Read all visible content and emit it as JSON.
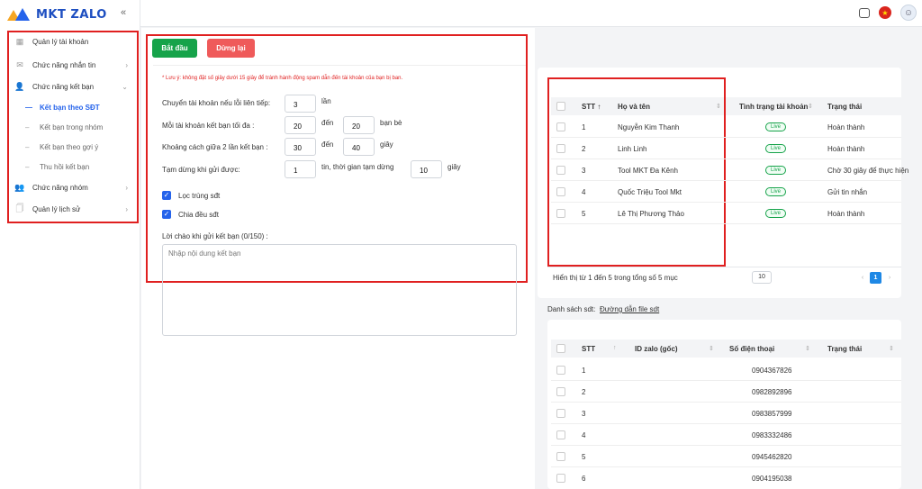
{
  "app": {
    "logo_text": "MKT ZALO",
    "collapse_icon": "«"
  },
  "sidebar": {
    "items": [
      {
        "label": "Quản lý tài khoản",
        "icon": "account-icon",
        "glyph": "▦"
      },
      {
        "label": "Chức năng nhắn tin",
        "icon": "mail-icon",
        "glyph": "✉",
        "chevron": "›"
      },
      {
        "label": "Chức năng kết bạn",
        "icon": "add-friend-icon",
        "glyph": "👤",
        "chevron": "⌄"
      },
      {
        "label": "Chức năng nhóm",
        "icon": "group-icon",
        "glyph": "👥",
        "chevron": "›"
      },
      {
        "label": "Quản lý lịch sử",
        "icon": "history-icon",
        "glyph": "🗍",
        "chevron": "›"
      }
    ],
    "subitems": [
      {
        "label": "Kết bạn theo SĐT",
        "active": true
      },
      {
        "label": "Kết bạn trong nhóm",
        "active": false
      },
      {
        "label": "Kết bạn theo gợi ý",
        "active": false
      },
      {
        "label": "Thu hồi kết bạn",
        "active": false
      }
    ]
  },
  "topbar": {
    "icons": [
      "tablet-icon",
      "vietnam-flag-icon",
      "user-avatar-icon"
    ]
  },
  "actions": {
    "start_label": "Bắt đầu",
    "stop_label": "Dừng lại"
  },
  "form": {
    "note": "* Lưu ý: không đặt số giây dưới 15 giây để tránh hành động spam dẫn đến tài khoản của bạn bị ban.",
    "switch_label": "Chuyển tài khoản nếu lỗi liên tiếp:",
    "switch_value": "3",
    "switch_unit": "lần",
    "max_label": "Mỗi tài khoản kết bạn tối đa :",
    "max_from": "20",
    "max_to_word": "đến",
    "max_to": "20",
    "max_unit": "bạn bè",
    "gap_label": "Khoảng cách giữa 2 lần kết bạn :",
    "gap_from": "30",
    "gap_to_word": "đến",
    "gap_to": "40",
    "gap_unit": "giây",
    "pause_label": "Tạm dừng khi gửi được:",
    "pause_value": "1",
    "pause_mid": "tin, thời gian tạm dừng",
    "pause_seconds": "10",
    "pause_unit": "giây",
    "filter_label": "Lọc trùng sđt",
    "split_label": "Chia đều sđt",
    "greeting_label": "Lời chào khi gửi kết bạn (0/150) :",
    "greeting_placeholder": "Nhập nội dung kết bạn"
  },
  "accounts_table": {
    "headers": {
      "stt": "STT ↑",
      "name": "Họ và tên",
      "status": "Tình trạng tài khoản",
      "state": "Trạng thái"
    },
    "rows": [
      {
        "stt": "1",
        "name": "Nguyễn Kim Thanh",
        "live": "Live",
        "state": "Hoàn thành"
      },
      {
        "stt": "2",
        "name": "Linh Linh",
        "live": "Live",
        "state": "Hoàn thành"
      },
      {
        "stt": "3",
        "name": "Tool MKT Đa Kênh",
        "live": "Live",
        "state": "Chờ 30 giây để thực hiện"
      },
      {
        "stt": "4",
        "name": "Quốc Triệu Tool Mkt",
        "live": "Live",
        "state": "Gửi tin nhắn"
      },
      {
        "stt": "5",
        "name": "Lê Thị Phương Thảo",
        "live": "Live",
        "state": "Hoàn thành"
      }
    ],
    "pager_text": "Hiển thị từ 1 đến 5 trong tổng số 5 mục",
    "page_size": "10",
    "current_page": "1"
  },
  "phones": {
    "list_label": "Danh sách sdt:",
    "link_label": "Đường dẫn file sdt",
    "headers": {
      "stt": "STT",
      "id": "ID zalo (gốc)",
      "phone": "Số điện thoại",
      "state": "Trạng thái"
    },
    "rows": [
      {
        "stt": "1",
        "phone": "0904367826"
      },
      {
        "stt": "2",
        "phone": "0982892896"
      },
      {
        "stt": "3",
        "phone": "0983857999"
      },
      {
        "stt": "4",
        "phone": "0983332486"
      },
      {
        "stt": "5",
        "phone": "0945462820"
      },
      {
        "stt": "6",
        "phone": "0904195038"
      }
    ]
  }
}
